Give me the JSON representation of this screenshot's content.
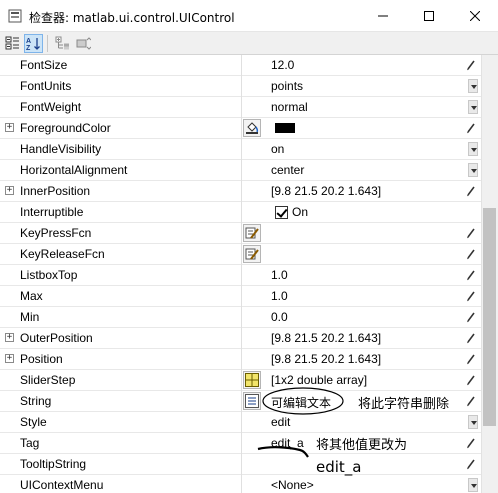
{
  "window": {
    "title": "检查器: matlab.ui.control.UIControl",
    "minimize_label": "minimize",
    "maximize_label": "maximize",
    "close_label": "close"
  },
  "toolbar": {
    "buttons": [
      "categorized-icon",
      "sort-alpha-icon",
      "expand-all-icon",
      "collapse-all-icon"
    ]
  },
  "properties": [
    {
      "name": "FontSize",
      "value": "12.0",
      "control": "edit"
    },
    {
      "name": "FontUnits",
      "value": "points",
      "control": "dropdown"
    },
    {
      "name": "FontWeight",
      "value": "normal",
      "control": "dropdown"
    },
    {
      "name": "ForegroundColor",
      "value": "",
      "control": "color",
      "expandable": true,
      "icon": "paint-bucket-icon",
      "swatch_color": "#000000"
    },
    {
      "name": "HandleVisibility",
      "value": "on",
      "control": "dropdown"
    },
    {
      "name": "HorizontalAlignment",
      "value": "center",
      "control": "dropdown"
    },
    {
      "name": "InnerPosition",
      "value": "[9.8 21.5 20.2 1.643]",
      "control": "edit",
      "expandable": true
    },
    {
      "name": "Interruptible",
      "value": "On",
      "control": "checkbox",
      "checked": true
    },
    {
      "name": "KeyPressFcn",
      "value": "",
      "control": "edit",
      "icon": "callback-pencil-icon"
    },
    {
      "name": "KeyReleaseFcn",
      "value": "",
      "control": "edit",
      "icon": "callback-pencil-icon"
    },
    {
      "name": "ListboxTop",
      "value": "1.0",
      "control": "edit"
    },
    {
      "name": "Max",
      "value": "1.0",
      "control": "edit"
    },
    {
      "name": "Min",
      "value": "0.0",
      "control": "edit"
    },
    {
      "name": "OuterPosition",
      "value": "[9.8 21.5 20.2 1.643]",
      "control": "edit",
      "expandable": true
    },
    {
      "name": "Position",
      "value": "[9.8 21.5 20.2 1.643]",
      "control": "edit",
      "expandable": true
    },
    {
      "name": "SliderStep",
      "value": "[1x2  double array]",
      "control": "edit",
      "icon": "array-grid-icon"
    },
    {
      "name": "String",
      "value": "可编辑文本",
      "control": "edit",
      "icon": "text-list-icon"
    },
    {
      "name": "Style",
      "value": "edit",
      "control": "dropdown"
    },
    {
      "name": "Tag",
      "value": "edit_a",
      "control": "edit"
    },
    {
      "name": "TooltipString",
      "value": "",
      "control": "edit"
    },
    {
      "name": "UIContextMenu",
      "value": "<None>",
      "control": "dropdown"
    }
  ],
  "annotations": {
    "string_note": "将此字符串删除",
    "tag_note": "将其他值更改为",
    "tag_target": "edit_a"
  },
  "colors": {
    "grid_divider": "#e8e8e8",
    "toolbar_bg": "#f0f0f0",
    "pressed_button_bg": "#cce4f7",
    "scroll_thumb": "#c2c2c2"
  }
}
